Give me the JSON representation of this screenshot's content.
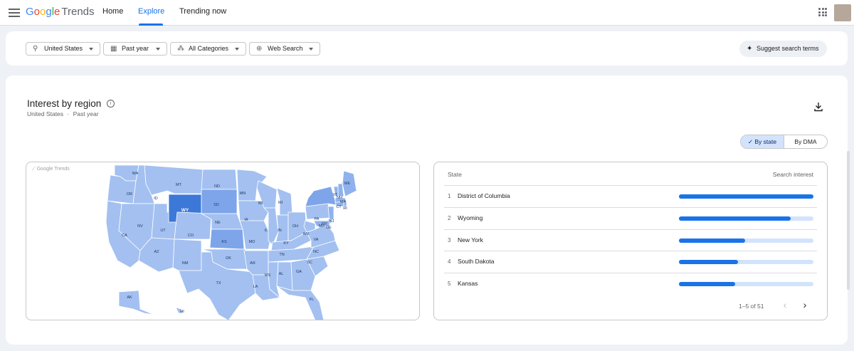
{
  "header": {
    "logo_google": [
      "G",
      "o",
      "o",
      "g",
      "l",
      "e"
    ],
    "logo_trends": "Trends",
    "tabs": [
      {
        "label": "Home"
      },
      {
        "label": "Explore"
      },
      {
        "label": "Trending now"
      }
    ],
    "active_tab": "Explore"
  },
  "filters": {
    "location": "United States",
    "time": "Past year",
    "category": "All Categories",
    "search_type": "Web Search",
    "suggest_label": "Suggest search terms"
  },
  "section": {
    "title": "Interest by region",
    "subtitle_region": "United States",
    "subtitle_sep": "·",
    "subtitle_time": "Past year",
    "toggle_state": "By state",
    "toggle_dma": "By DMA"
  },
  "map": {
    "watermark": "Google Trends",
    "highlight_color": "#3c78d8",
    "base_color": "#a3c0f0",
    "states": [
      "WA",
      "OR",
      "CA",
      "ID",
      "NV",
      "UT",
      "AZ",
      "MT",
      "WY",
      "CO",
      "NM",
      "ND",
      "SD",
      "NE",
      "KS",
      "OK",
      "TX",
      "MN",
      "IA",
      "MO",
      "AR",
      "LA",
      "WI",
      "IL",
      "MI",
      "IN",
      "OH",
      "KY",
      "TN",
      "MS",
      "AL",
      "GA",
      "FL",
      "SC",
      "NC",
      "VA",
      "WV",
      "PA",
      "NY",
      "ME",
      "VT",
      "NH",
      "MA",
      "CT",
      "NJ",
      "DE",
      "MD",
      "RI",
      "AK",
      "HI"
    ]
  },
  "table": {
    "col_state": "State",
    "col_interest": "Search interest",
    "rows": [
      {
        "rank": "1",
        "name": "District of Columbia",
        "value": 100
      },
      {
        "rank": "2",
        "name": "Wyoming",
        "value": 83
      },
      {
        "rank": "3",
        "name": "New York",
        "value": 49
      },
      {
        "rank": "4",
        "name": "South Dakota",
        "value": 44
      },
      {
        "rank": "5",
        "name": "Kansas",
        "value": 42
      }
    ],
    "pager": "1–5 of 51"
  }
}
